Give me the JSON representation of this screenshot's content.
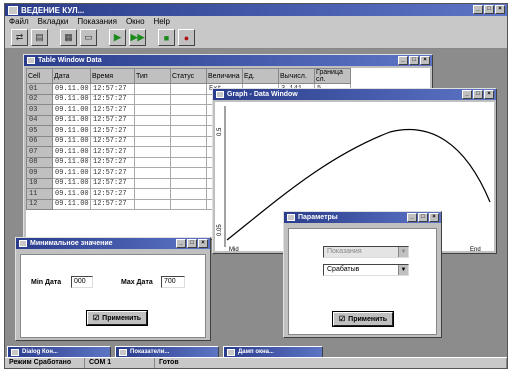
{
  "app": {
    "title": "ВЕДЕНИЕ КУЛ...",
    "controls": [
      "_",
      "□",
      "×"
    ]
  },
  "menu": [
    "Файл",
    "Вкладки",
    "Показания",
    "Окно",
    "Help"
  ],
  "toolbar": [
    "ico-1",
    "ico-2",
    "ico-3",
    "ico-4",
    "ico-5",
    "ico-6",
    "ico-7",
    "ico-8"
  ],
  "table_window": {
    "title": "Table Window Data",
    "columns": [
      "Cell",
      "Дата",
      "Время",
      "Тип",
      "Статус",
      "Величина",
      "Ед.",
      "Вычисл.",
      "Граница сл."
    ],
    "rows": [
      [
        "01",
        "09.11.00",
        "12:57:27",
        "",
        "",
        "Ext",
        "",
        "3.141",
        "5"
      ],
      [
        "02",
        "09.11.00",
        "12:57:27",
        "",
        "",
        "",
        "",
        "",
        ""
      ],
      [
        "03",
        "09.11.00",
        "12:57:27",
        "",
        "",
        "",
        "",
        "",
        ""
      ],
      [
        "04",
        "09.11.00",
        "12:57:27",
        "",
        "",
        "",
        "",
        "",
        ""
      ],
      [
        "05",
        "09.11.00",
        "12:57:27",
        "",
        "",
        "",
        "",
        "",
        ""
      ],
      [
        "06",
        "09.11.00",
        "12:57:27",
        "",
        "",
        "",
        "",
        "",
        ""
      ],
      [
        "07",
        "09.11.00",
        "12:57:27",
        "",
        "",
        "",
        "",
        "",
        ""
      ],
      [
        "08",
        "09.11.00",
        "12:57:27",
        "",
        "",
        "",
        "",
        "",
        ""
      ],
      [
        "09",
        "09.11.00",
        "12:57:27",
        "",
        "",
        "",
        "",
        "",
        ""
      ],
      [
        "10",
        "09.11.00",
        "12:57:27",
        "",
        "",
        "",
        "",
        "",
        ""
      ],
      [
        "11",
        "09.11.00",
        "12:57:27",
        "",
        "",
        "",
        "",
        "",
        ""
      ],
      [
        "12",
        "09.11.00",
        "12:57:27",
        "",
        "",
        "",
        "",
        "",
        ""
      ]
    ]
  },
  "graph_window": {
    "title": "Graph - Data Window",
    "y_top": "0.5",
    "y_bottom": "0.05",
    "x_left": "Mid",
    "x_right": "End"
  },
  "range_dialog": {
    "title": "Минимальное значение",
    "min_label": "Min Дата",
    "min_value": "000",
    "max_label": "Max Дата",
    "max_value": "700",
    "button": "Применить"
  },
  "param_dialog": {
    "title": "Параметры",
    "select1": "Показания",
    "select2": "Срабатыв",
    "button": "Применить"
  },
  "minimized": [
    "Dialog Кон...",
    "Показатели...",
    "Дамп окна..."
  ],
  "status": [
    "Режим Сработано",
    "COM 1",
    "Готов"
  ],
  "colors": {
    "desktop": "#8c8c8c",
    "title": "#2a3c8c",
    "curve": "#000000"
  }
}
